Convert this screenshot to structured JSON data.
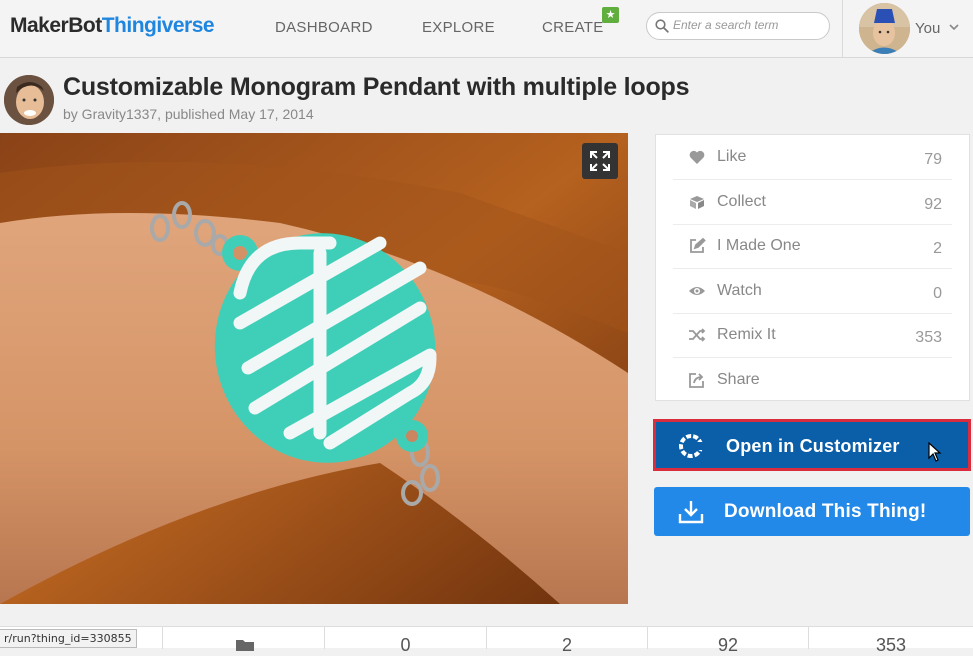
{
  "brand": {
    "part1": "MakerBot",
    "part2": "Thingiverse"
  },
  "nav": {
    "dashboard": "DASHBOARD",
    "explore": "EXPLORE",
    "create": "CREATE",
    "create_badge": "★"
  },
  "search": {
    "placeholder": "Enter a search term"
  },
  "user": {
    "label": "You"
  },
  "thing": {
    "title": "Customizable Monogram Pendant with multiple loops",
    "byline": "by Gravity1337, published May 17, 2014"
  },
  "actions": [
    {
      "label": "Like",
      "count": "79",
      "icon": "heart-icon"
    },
    {
      "label": "Collect",
      "count": "92",
      "icon": "collect-icon"
    },
    {
      "label": "I Made One",
      "count": "2",
      "icon": "made-one-icon"
    },
    {
      "label": "Watch",
      "count": "0",
      "icon": "eye-icon"
    },
    {
      "label": "Remix It",
      "count": "353",
      "icon": "remix-icon"
    },
    {
      "label": "Share",
      "count": "",
      "icon": "share-icon"
    }
  ],
  "buttons": {
    "customizer": "Open in Customizer",
    "download": "Download This Thing!"
  },
  "stats": {
    "s2": "0",
    "s3": "2",
    "s4": "92",
    "s5": "353"
  },
  "status_url": "r/run?thing_id=330855",
  "colors": {
    "brand_blue": "#1f86e0",
    "customizer_bg": "#0b5ea8",
    "highlight_border": "#d92c3c",
    "download_bg": "#2389e8",
    "pendant": "#3fcfb8"
  }
}
